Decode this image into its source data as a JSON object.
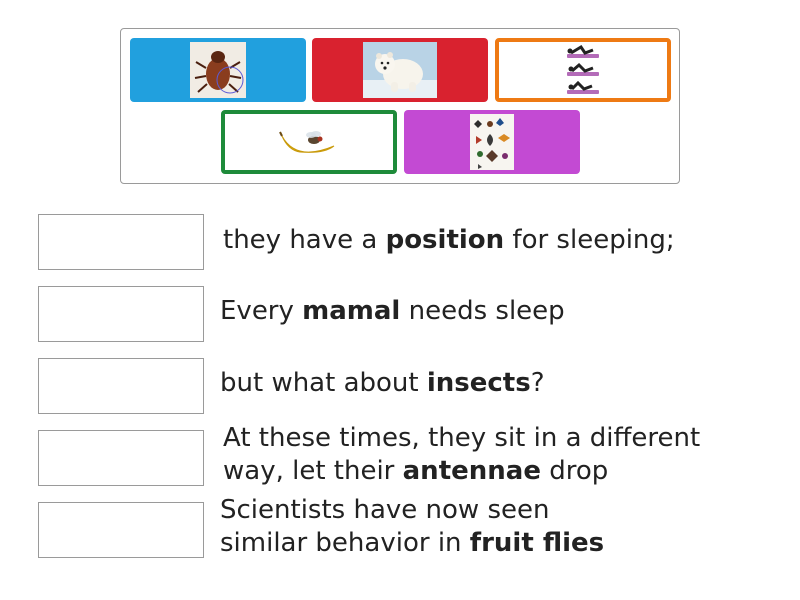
{
  "tiles": [
    {
      "id": "beetle",
      "icon": "beetle-photo-icon",
      "color": "#21a0de"
    },
    {
      "id": "polar-bear",
      "icon": "polar-bear-photo-icon",
      "color": "#d9222f"
    },
    {
      "id": "sleeping-positions",
      "icon": "sleeping-positions-photo-icon",
      "color": "#ee7a14"
    },
    {
      "id": "fruit-fly-banana",
      "icon": "fruit-fly-on-banana-photo-icon",
      "color": "#1e8b3a"
    },
    {
      "id": "insect-collection",
      "icon": "insect-collection-photo-icon",
      "color": "#c34ad3"
    }
  ],
  "clues": [
    {
      "before": "they have a ",
      "bold": "position",
      "after": " for sleeping;"
    },
    {
      "before": "Every ",
      "bold": "mamal",
      "after": " needs sleep"
    },
    {
      "before": "but what about ",
      "bold": "insects",
      "after": "?"
    },
    {
      "line1": "At these times, they sit in a different",
      "line2_before": "way, let their ",
      "bold": "antennae",
      "line2_after": " drop"
    },
    {
      "line1": "Scientists have now seen",
      "line2_before": "similar behavior in ",
      "bold": "fruit flies",
      "line2_after": ""
    }
  ]
}
